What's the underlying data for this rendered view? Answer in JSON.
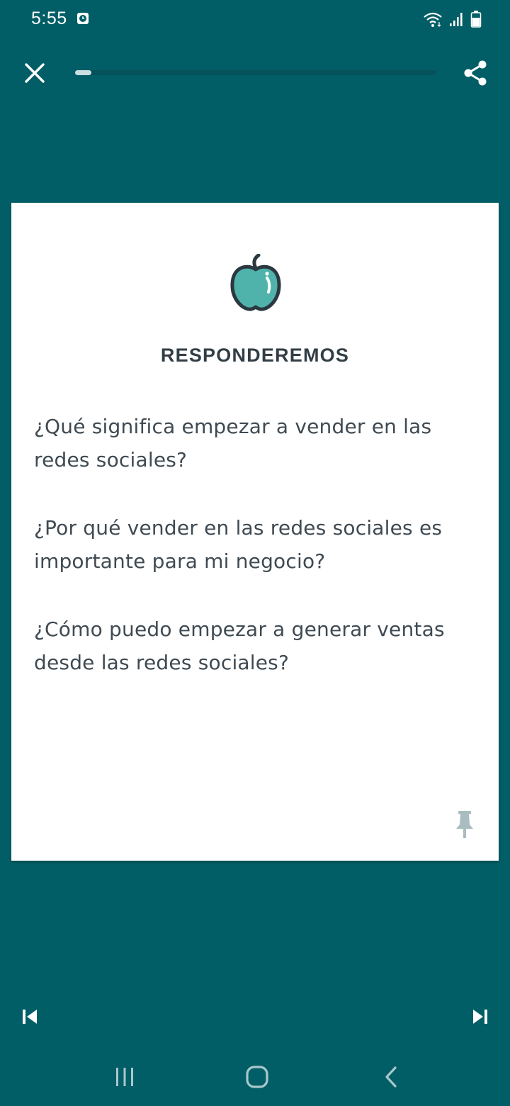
{
  "status_bar": {
    "time": "5:55",
    "icons": [
      "alarm-clock-icon",
      "wifi-icon",
      "signal-icon",
      "battery-icon"
    ]
  },
  "top_bar": {
    "close_icon": "close-icon",
    "share_icon": "share-icon",
    "progress": 0.045
  },
  "card": {
    "icon": "apple-icon",
    "title": "RESPONDEREMOS",
    "questions": [
      "¿Qué significa empezar a vender en las redes sociales?",
      "¿Por qué vender en las redes sociales es importante para mi negocio?",
      "¿Cómo puedo empezar a generar ventas desde las redes sociales?"
    ],
    "pin_icon": "pin-icon"
  },
  "navigation": {
    "prev_icon": "skip-previous-icon",
    "next_icon": "skip-next-icon"
  },
  "system_nav": {
    "recents_icon": "recents-icon",
    "home_icon": "home-icon",
    "back_icon": "back-icon"
  },
  "colors": {
    "background": "#025e66",
    "card": "#ffffff",
    "title_text": "#323e46",
    "body_text": "#3f4a52",
    "apple_fill": "#4fb3ac",
    "pin": "#a9bcbf"
  }
}
